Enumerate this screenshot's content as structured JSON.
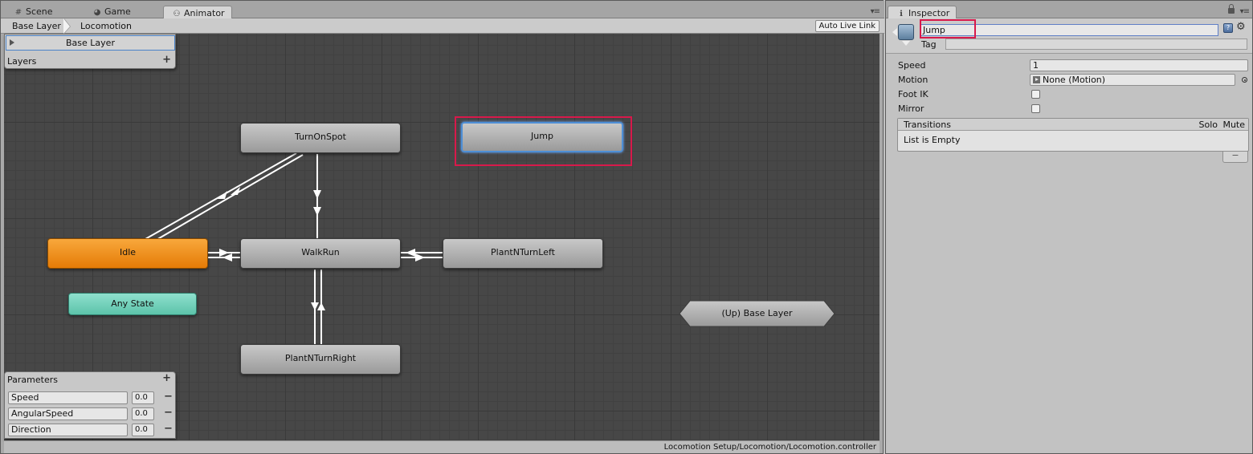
{
  "animator": {
    "tabs": [
      {
        "label": "Scene",
        "icon": "#"
      },
      {
        "label": "Game",
        "icon": "◕"
      },
      {
        "label": "Animator",
        "icon": "⚇"
      }
    ],
    "breadcrumb": [
      "Base Layer",
      "Locomotion"
    ],
    "auto_live_link": "Auto Live Link",
    "layers_panel": {
      "selected_layer": "Base Layer",
      "title": "Layers",
      "add": "+"
    },
    "states": {
      "turn_on_spot": "TurnOnSpot",
      "jump": "Jump",
      "idle": "Idle",
      "walk_run": "WalkRun",
      "plant_n_turn_left": "PlantNTurnLeft",
      "plant_n_turn_right": "PlantNTurnRight",
      "any_state": "Any State",
      "up_base_layer": "(Up) Base Layer"
    },
    "parameters": {
      "title": "Parameters",
      "add": "+",
      "items": [
        {
          "name": "Speed",
          "value": "0.0",
          "remove": "−"
        },
        {
          "name": "AngularSpeed",
          "value": "0.0",
          "remove": "−"
        },
        {
          "name": "Direction",
          "value": "0.0",
          "remove": "−"
        }
      ]
    },
    "status_path": "Locomotion Setup/Locomotion/Locomotion.controller"
  },
  "inspector": {
    "tab": {
      "label": "Inspector",
      "icon": "ℹ"
    },
    "state_name": "Jump",
    "tag_label": "Tag",
    "tag_value": "",
    "props": {
      "speed_label": "Speed",
      "speed_value": "1",
      "motion_label": "Motion",
      "motion_value": "None (Motion)",
      "foot_ik_label": "Foot IK",
      "foot_ik_checked": false,
      "mirror_label": "Mirror",
      "mirror_checked": false
    },
    "transitions": {
      "title": "Transitions",
      "solo": "Solo",
      "mute": "Mute",
      "empty": "List is Empty",
      "remove": "−"
    }
  },
  "colors": {
    "idle_state": "#e57b06",
    "any_state": "#5cc3aa",
    "selection_highlight": "#d8194b",
    "graph_background": "#474747"
  }
}
